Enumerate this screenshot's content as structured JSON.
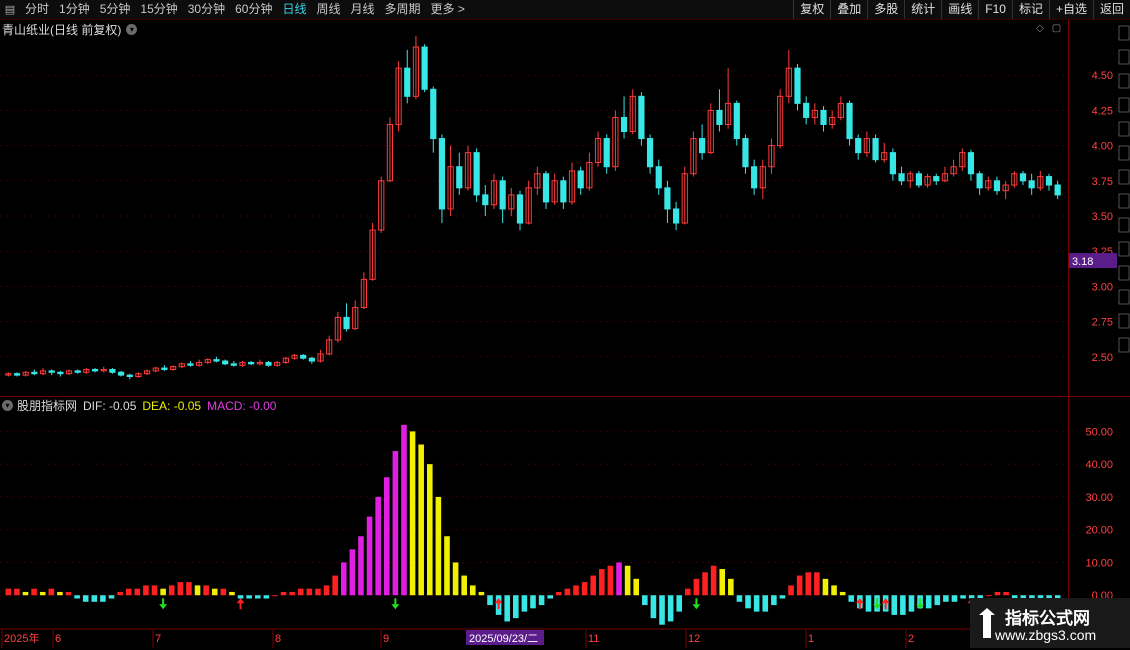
{
  "toolbar": {
    "periods": [
      {
        "label": "分时",
        "active": false
      },
      {
        "label": "1分钟",
        "active": false
      },
      {
        "label": "5分钟",
        "active": false
      },
      {
        "label": "15分钟",
        "active": false
      },
      {
        "label": "30分钟",
        "active": false
      },
      {
        "label": "60分钟",
        "active": false
      },
      {
        "label": "日线",
        "active": true
      },
      {
        "label": "周线",
        "active": false
      },
      {
        "label": "月线",
        "active": false
      },
      {
        "label": "多周期",
        "active": false
      },
      {
        "label": "更多 >",
        "active": false
      }
    ],
    "actions": [
      "复权",
      "叠加",
      "多股",
      "统计",
      "画线",
      "F10",
      "标记",
      "+自选",
      "返回"
    ]
  },
  "main_chart": {
    "title": "青山纸业(日线 前复权)",
    "price_ticks": [
      "4.50",
      "4.25",
      "4.00",
      "3.75",
      "3.50",
      "3.25",
      "3.00",
      "2.75",
      "2.50"
    ],
    "current_price": "3.18",
    "current_price_color": "#5a1d8a",
    "up_color": "#ff3c3c",
    "down_color": "#39e6e6"
  },
  "indicator": {
    "name": "股朋指标网",
    "dif_label": "DIF: -0.05",
    "dea_label": "DEA: -0.05",
    "macd_label": "MACD: -0.00",
    "ticks": [
      "50.00",
      "40.00",
      "30.00",
      "20.00",
      "10.00",
      "0.00"
    ]
  },
  "time_axis": {
    "labels": [
      "2025年",
      "6",
      "7",
      "8",
      "9",
      "11",
      "12",
      "1",
      "2"
    ],
    "cursor_date": "2025/09/23/二"
  },
  "watermark": {
    "title": "指标公式网",
    "url": "www.zbgs3.com"
  },
  "chart_data": {
    "type": "candlestick",
    "price_axis": {
      "min": 2.25,
      "max": 4.75
    },
    "indicator_axis": {
      "min": -10,
      "max": 55
    },
    "candles": [
      [
        2.37,
        2.38,
        2.39,
        2.36
      ],
      [
        2.38,
        2.37,
        2.39,
        2.36
      ],
      [
        2.37,
        2.39,
        2.4,
        2.36
      ],
      [
        2.39,
        2.38,
        2.41,
        2.37
      ],
      [
        2.38,
        2.4,
        2.42,
        2.37
      ],
      [
        2.4,
        2.39,
        2.41,
        2.37
      ],
      [
        2.39,
        2.38,
        2.4,
        2.36
      ],
      [
        2.38,
        2.4,
        2.41,
        2.37
      ],
      [
        2.4,
        2.39,
        2.41,
        2.38
      ],
      [
        2.39,
        2.41,
        2.42,
        2.38
      ],
      [
        2.41,
        2.4,
        2.42,
        2.39
      ],
      [
        2.4,
        2.41,
        2.43,
        2.39
      ],
      [
        2.41,
        2.39,
        2.42,
        2.38
      ],
      [
        2.39,
        2.37,
        2.4,
        2.36
      ],
      [
        2.37,
        2.36,
        2.38,
        2.34
      ],
      [
        2.36,
        2.38,
        2.39,
        2.35
      ],
      [
        2.38,
        2.4,
        2.41,
        2.37
      ],
      [
        2.4,
        2.42,
        2.43,
        2.39
      ],
      [
        2.42,
        2.41,
        2.44,
        2.4
      ],
      [
        2.41,
        2.43,
        2.44,
        2.4
      ],
      [
        2.43,
        2.45,
        2.46,
        2.42
      ],
      [
        2.45,
        2.44,
        2.47,
        2.43
      ],
      [
        2.44,
        2.46,
        2.48,
        2.43
      ],
      [
        2.46,
        2.48,
        2.49,
        2.45
      ],
      [
        2.48,
        2.47,
        2.5,
        2.46
      ],
      [
        2.47,
        2.45,
        2.48,
        2.44
      ],
      [
        2.45,
        2.44,
        2.47,
        2.43
      ],
      [
        2.44,
        2.46,
        2.47,
        2.43
      ],
      [
        2.46,
        2.45,
        2.47,
        2.44
      ],
      [
        2.45,
        2.46,
        2.48,
        2.44
      ],
      [
        2.46,
        2.44,
        2.47,
        2.43
      ],
      [
        2.44,
        2.46,
        2.47,
        2.43
      ],
      [
        2.46,
        2.49,
        2.5,
        2.45
      ],
      [
        2.49,
        2.51,
        2.52,
        2.48
      ],
      [
        2.51,
        2.49,
        2.52,
        2.48
      ],
      [
        2.49,
        2.47,
        2.5,
        2.45
      ],
      [
        2.47,
        2.52,
        2.55,
        2.46
      ],
      [
        2.52,
        2.62,
        2.65,
        2.51
      ],
      [
        2.62,
        2.78,
        2.82,
        2.6
      ],
      [
        2.78,
        2.7,
        2.88,
        2.68
      ],
      [
        2.7,
        2.85,
        2.9,
        2.69
      ],
      [
        2.85,
        3.05,
        3.1,
        2.84
      ],
      [
        3.05,
        3.4,
        3.45,
        3.04
      ],
      [
        3.4,
        3.75,
        3.78,
        3.38
      ],
      [
        3.75,
        4.15,
        4.2,
        3.74
      ],
      [
        4.15,
        4.55,
        4.6,
        4.1
      ],
      [
        4.55,
        4.35,
        4.68,
        4.3
      ],
      [
        4.35,
        4.7,
        4.78,
        4.33
      ],
      [
        4.7,
        4.4,
        4.72,
        4.38
      ],
      [
        4.4,
        4.05,
        4.42,
        3.95
      ],
      [
        4.05,
        3.55,
        4.08,
        3.45
      ],
      [
        3.55,
        3.85,
        4.0,
        3.5
      ],
      [
        3.85,
        3.7,
        3.95,
        3.65
      ],
      [
        3.7,
        3.95,
        4.0,
        3.68
      ],
      [
        3.95,
        3.65,
        3.98,
        3.6
      ],
      [
        3.65,
        3.58,
        3.72,
        3.5
      ],
      [
        3.58,
        3.75,
        3.8,
        3.55
      ],
      [
        3.75,
        3.55,
        3.78,
        3.45
      ],
      [
        3.55,
        3.65,
        3.7,
        3.5
      ],
      [
        3.65,
        3.45,
        3.68,
        3.4
      ],
      [
        3.45,
        3.7,
        3.75,
        3.44
      ],
      [
        3.7,
        3.8,
        3.85,
        3.65
      ],
      [
        3.8,
        3.6,
        3.82,
        3.55
      ],
      [
        3.6,
        3.75,
        3.8,
        3.58
      ],
      [
        3.75,
        3.6,
        3.78,
        3.55
      ],
      [
        3.6,
        3.82,
        3.88,
        3.58
      ],
      [
        3.82,
        3.7,
        3.85,
        3.65
      ],
      [
        3.7,
        3.88,
        3.95,
        3.68
      ],
      [
        3.88,
        4.05,
        4.1,
        3.85
      ],
      [
        4.05,
        3.85,
        4.08,
        3.8
      ],
      [
        3.85,
        4.2,
        4.25,
        3.82
      ],
      [
        4.2,
        4.1,
        4.35,
        4.05
      ],
      [
        4.1,
        4.35,
        4.4,
        4.08
      ],
      [
        4.35,
        4.05,
        4.38,
        4.0
      ],
      [
        4.05,
        3.85,
        4.08,
        3.8
      ],
      [
        3.85,
        3.7,
        3.9,
        3.65
      ],
      [
        3.7,
        3.55,
        3.75,
        3.45
      ],
      [
        3.55,
        3.45,
        3.6,
        3.4
      ],
      [
        3.45,
        3.8,
        3.85,
        3.44
      ],
      [
        3.8,
        4.05,
        4.1,
        3.78
      ],
      [
        4.05,
        3.95,
        4.15,
        3.9
      ],
      [
        3.95,
        4.25,
        4.3,
        3.94
      ],
      [
        4.25,
        4.15,
        4.4,
        4.1
      ],
      [
        4.15,
        4.3,
        4.55,
        4.12
      ],
      [
        4.3,
        4.05,
        4.32,
        4.0
      ],
      [
        4.05,
        3.85,
        4.08,
        3.8
      ],
      [
        3.85,
        3.7,
        3.9,
        3.65
      ],
      [
        3.7,
        3.85,
        3.9,
        3.62
      ],
      [
        3.85,
        4.0,
        4.05,
        3.8
      ],
      [
        4.0,
        4.35,
        4.4,
        3.98
      ],
      [
        4.35,
        4.55,
        4.68,
        4.3
      ],
      [
        4.55,
        4.3,
        4.58,
        4.25
      ],
      [
        4.3,
        4.2,
        4.35,
        4.15
      ],
      [
        4.2,
        4.25,
        4.3,
        4.15
      ],
      [
        4.25,
        4.15,
        4.28,
        4.1
      ],
      [
        4.15,
        4.2,
        4.25,
        4.12
      ],
      [
        4.2,
        4.3,
        4.35,
        4.18
      ],
      [
        4.3,
        4.05,
        4.32,
        4.0
      ],
      [
        4.05,
        3.95,
        4.08,
        3.9
      ],
      [
        3.95,
        4.05,
        4.1,
        3.92
      ],
      [
        4.05,
        3.9,
        4.08,
        3.88
      ],
      [
        3.9,
        3.95,
        4.02,
        3.88
      ],
      [
        3.95,
        3.8,
        3.98,
        3.75
      ],
      [
        3.8,
        3.75,
        3.85,
        3.72
      ],
      [
        3.75,
        3.8,
        3.82,
        3.7
      ],
      [
        3.8,
        3.72,
        3.82,
        3.7
      ],
      [
        3.72,
        3.78,
        3.8,
        3.7
      ],
      [
        3.78,
        3.75,
        3.8,
        3.72
      ],
      [
        3.75,
        3.8,
        3.85,
        3.74
      ],
      [
        3.8,
        3.85,
        3.9,
        3.78
      ],
      [
        3.85,
        3.95,
        3.98,
        3.82
      ],
      [
        3.95,
        3.8,
        3.97,
        3.75
      ],
      [
        3.8,
        3.7,
        3.82,
        3.65
      ],
      [
        3.7,
        3.75,
        3.78,
        3.68
      ],
      [
        3.75,
        3.68,
        3.78,
        3.65
      ],
      [
        3.68,
        3.72,
        3.75,
        3.62
      ],
      [
        3.72,
        3.8,
        3.82,
        3.7
      ],
      [
        3.8,
        3.75,
        3.82,
        3.72
      ],
      [
        3.75,
        3.7,
        3.8,
        3.65
      ],
      [
        3.7,
        3.78,
        3.82,
        3.68
      ],
      [
        3.78,
        3.72,
        3.8,
        3.68
      ],
      [
        3.72,
        3.65,
        3.75,
        3.62
      ]
    ],
    "macd_histogram": [
      2,
      2,
      1,
      2,
      1,
      2,
      1,
      1,
      -1,
      -2,
      -2,
      -2,
      -1,
      1,
      2,
      2,
      3,
      3,
      2,
      3,
      4,
      4,
      3,
      3,
      2,
      2,
      1,
      -1,
      -1,
      -1,
      -1,
      0,
      1,
      1,
      2,
      2,
      2,
      3,
      6,
      10,
      14,
      18,
      24,
      30,
      36,
      44,
      52,
      50,
      46,
      40,
      30,
      18,
      10,
      6,
      3,
      1,
      -3,
      -6,
      -8,
      -7,
      -5,
      -4,
      -3,
      -1,
      1,
      2,
      3,
      4,
      6,
      8,
      9,
      10,
      9,
      5,
      -3,
      -7,
      -9,
      -8,
      -5,
      2,
      5,
      7,
      9,
      8,
      5,
      -2,
      -4,
      -5,
      -5,
      -3,
      -1,
      3,
      6,
      7,
      7,
      5,
      3,
      1,
      -2,
      -4,
      -5,
      -5,
      -5,
      -6,
      -6,
      -5,
      -4,
      -4,
      -3,
      -2,
      -2,
      -1,
      -1,
      -1,
      0,
      1,
      1,
      -1,
      -2,
      -2,
      -2,
      -1,
      -1
    ],
    "signals": [
      {
        "index": 18,
        "type": "sell"
      },
      {
        "index": 27,
        "type": "buy"
      },
      {
        "index": 45,
        "type": "sell"
      },
      {
        "index": 57,
        "type": "buy"
      },
      {
        "index": 80,
        "type": "sell"
      },
      {
        "index": 99,
        "type": "buy"
      },
      {
        "index": 101,
        "type": "sell"
      },
      {
        "index": 102,
        "type": "buy"
      },
      {
        "index": 106,
        "type": "sell"
      },
      {
        "index": 112,
        "type": "buy"
      },
      {
        "index": 117,
        "type": "sell"
      },
      {
        "index": 122,
        "type": "buy"
      },
      {
        "index": 128,
        "type": "sell"
      },
      {
        "index": 130,
        "type": "buy"
      },
      {
        "index": 131,
        "type": "sell"
      }
    ]
  }
}
